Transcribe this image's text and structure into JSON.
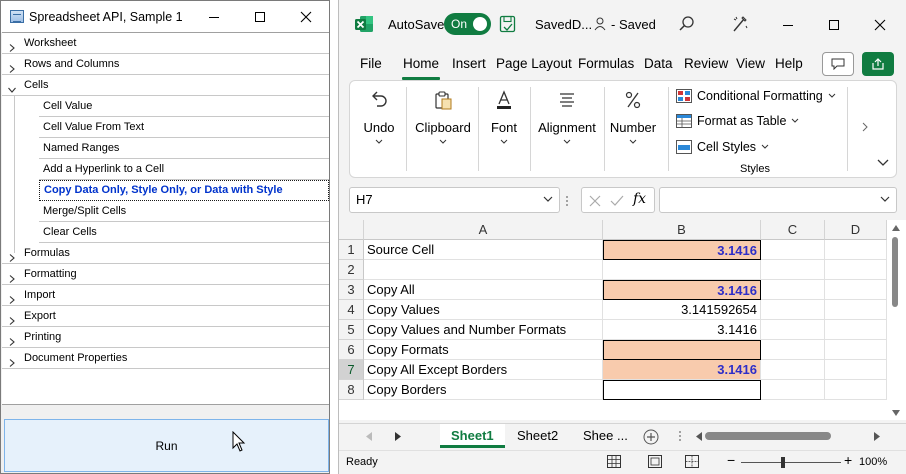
{
  "left_window": {
    "title": "Spreadsheet API, Sample 1",
    "tree": [
      {
        "label": "Worksheet",
        "expanded": false
      },
      {
        "label": "Rows and Columns",
        "expanded": false
      },
      {
        "label": "Cells",
        "expanded": true,
        "children": [
          {
            "label": "Cell Value"
          },
          {
            "label": "Cell Value From Text"
          },
          {
            "label": "Named Ranges"
          },
          {
            "label": "Add a Hyperlink to a Cell"
          },
          {
            "label": "Copy Data Only, Style Only, or Data with Style",
            "selected": true
          },
          {
            "label": "Merge/Split Cells"
          },
          {
            "label": "Clear Cells"
          }
        ]
      },
      {
        "label": "Formulas",
        "expanded": false
      },
      {
        "label": "Formatting",
        "expanded": false
      },
      {
        "label": "Import",
        "expanded": false
      },
      {
        "label": "Export",
        "expanded": false
      },
      {
        "label": "Printing",
        "expanded": false
      },
      {
        "label": "Document Properties",
        "expanded": false
      }
    ],
    "run_button": "Run"
  },
  "excel": {
    "autosave_label": "AutoSave",
    "autosave_state": "On",
    "doc_title": "SavedD...",
    "status": "Saved",
    "tabs": [
      "File",
      "Home",
      "Insert",
      "Page Layout",
      "Formulas",
      "Data",
      "Review",
      "View",
      "Help"
    ],
    "active_tab": "Home",
    "ribbon": {
      "undo": "Undo",
      "clipboard": "Clipboard",
      "font": "Font",
      "alignment": "Alignment",
      "number": "Number",
      "conditional_formatting": "Conditional Formatting",
      "format_as_table": "Format as Table",
      "cell_styles": "Cell Styles",
      "styles_group": "Styles"
    },
    "name_box": "H7",
    "formula_value": "",
    "fx_label": "fx",
    "columns": [
      "A",
      "B",
      "C",
      "D"
    ],
    "rows": [
      {
        "n": "1",
        "a": "Source Cell",
        "b": "3.1416",
        "b_style": "fill-bold"
      },
      {
        "n": "2",
        "a": "",
        "b": "",
        "b_style": ""
      },
      {
        "n": "3",
        "a": "Copy All",
        "b": "3.1416",
        "b_style": "fill-bold"
      },
      {
        "n": "4",
        "a": "Copy Values",
        "b": "3.141592654",
        "b_style": "plain"
      },
      {
        "n": "5",
        "a": "Copy Values and Number Formats",
        "b": "3.1416",
        "b_style": "plain"
      },
      {
        "n": "6",
        "a": "Copy Formats",
        "b": "",
        "b_style": "fill"
      },
      {
        "n": "7",
        "a": "Copy All Except Borders",
        "b": "3.1416",
        "b_style": "fill-bold-noborder"
      },
      {
        "n": "8",
        "a": "Copy Borders",
        "b": "",
        "b_style": "border"
      }
    ],
    "selected_row": "7",
    "sheets": [
      "Sheet1",
      "Sheet2",
      "Shee ..."
    ],
    "active_sheet": "Sheet1",
    "status_ready": "Ready",
    "zoom": "100%",
    "colors": {
      "brand": "#107c41",
      "fill": "#f8cbad",
      "value_text": "#2e2ec8"
    }
  }
}
